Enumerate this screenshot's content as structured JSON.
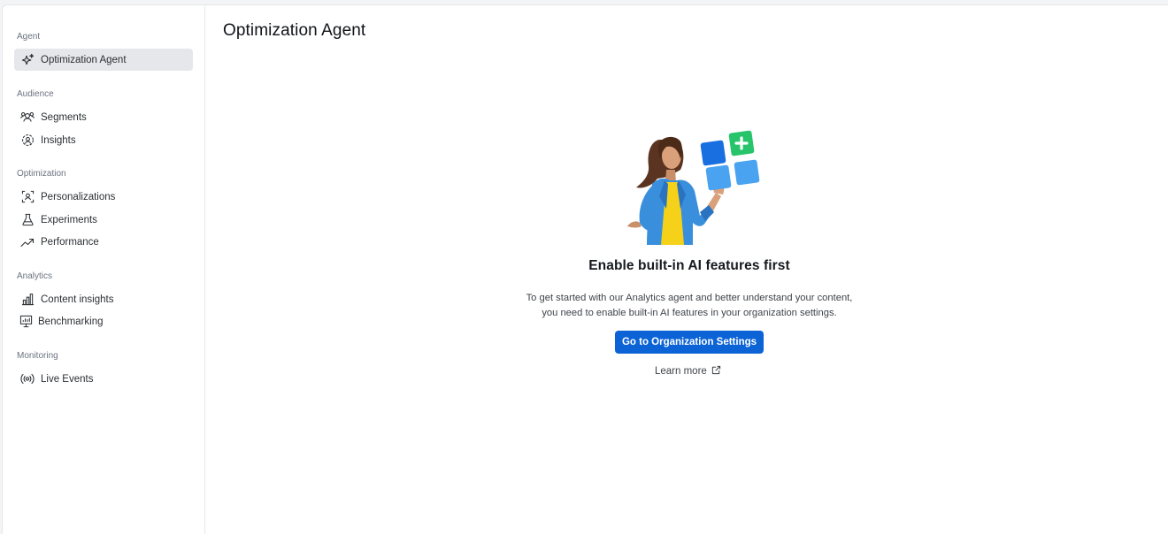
{
  "sidebar": {
    "sections": [
      {
        "label": "Agent",
        "items": [
          {
            "label": "Optimization Agent",
            "icon": "sparkle-icon",
            "active": true
          }
        ]
      },
      {
        "label": "Audience",
        "items": [
          {
            "label": "Segments",
            "icon": "users-icon"
          },
          {
            "label": "Insights",
            "icon": "user-circle-icon"
          }
        ]
      },
      {
        "label": "Optimization",
        "items": [
          {
            "label": "Personalizations",
            "icon": "user-focus-icon"
          },
          {
            "label": "Experiments",
            "icon": "flask-icon"
          },
          {
            "label": "Performance",
            "icon": "trend-up-icon"
          }
        ]
      },
      {
        "label": "Analytics",
        "items": [
          {
            "label": "Content insights",
            "icon": "bar-chart-icon"
          },
          {
            "label": "Benchmarking",
            "icon": "presentation-chart-icon"
          }
        ]
      },
      {
        "label": "Monitoring",
        "items": [
          {
            "label": "Live Events",
            "icon": "broadcast-icon"
          }
        ]
      }
    ]
  },
  "main": {
    "title": "Optimization Agent",
    "empty_state": {
      "illustration": "woman-with-app-tiles-illustration",
      "title": "Enable built-in AI features first",
      "description_line1": "To get started with our Analytics agent and better understand your content,",
      "description_line2": "you need to enable built-in AI features in your organization settings.",
      "button_label": "Go to Organization Settings",
      "link_label": "Learn more",
      "link_icon": "external-link-icon"
    }
  },
  "colors": {
    "primary_button": "#0b63d6",
    "active_nav_bg": "#e5e7ea",
    "tile_dark_blue": "#1a6fe0",
    "tile_light_blue": "#4aa3f0",
    "tile_green": "#27c46b"
  }
}
